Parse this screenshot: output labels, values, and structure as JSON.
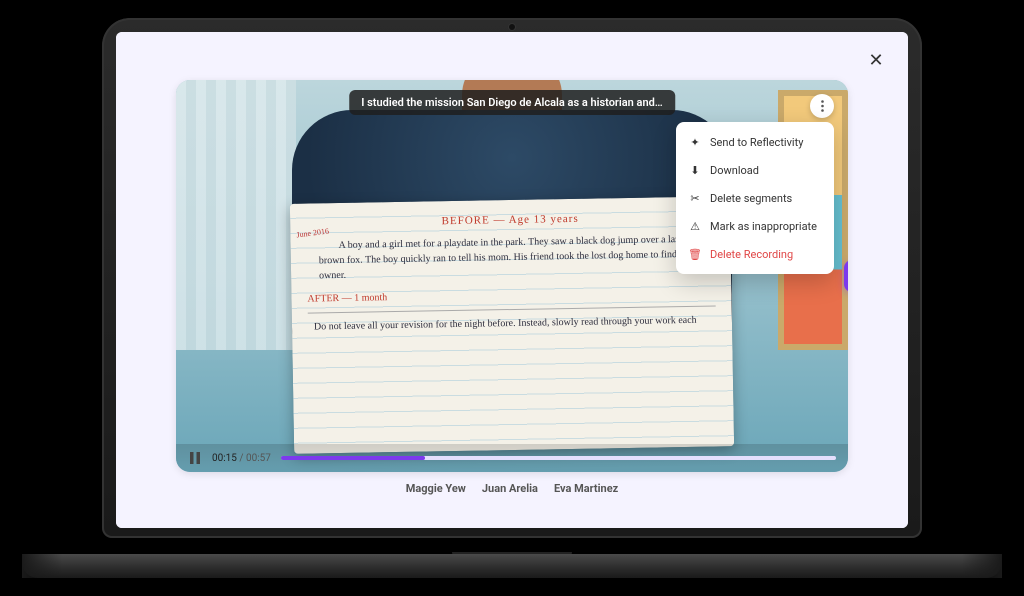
{
  "colors": {
    "accent": "#7c3aed",
    "danger": "#e04646"
  },
  "close_label": "✕",
  "caption": {
    "text": "I studied the mission San Diego de Alcala as a historian and…"
  },
  "paper": {
    "side_date": "June 2016",
    "heading_before": "BEFORE — Age 13 years",
    "paragraph": "A boy and a girl met for a playdate in the park. They saw a black dog jump over a lazy brown fox. The boy quickly ran to tell his mom. His friend took the lost dog home to find it's owner.",
    "heading_after": "AFTER — 1 month",
    "paragraph2": "Do not leave all your revision for the night before. Instead, slowly read through your work each"
  },
  "menu": {
    "items": [
      {
        "icon": "sparkle-icon",
        "glyph": "✦",
        "label": "Send to Reflectivity",
        "danger": false
      },
      {
        "icon": "download-icon",
        "glyph": "⬇",
        "label": "Download",
        "danger": false
      },
      {
        "icon": "scissors-icon",
        "glyph": "✂",
        "label": "Delete segments",
        "danger": false
      },
      {
        "icon": "warning-icon",
        "glyph": "⚠",
        "label": "Mark as inappropriate",
        "danger": false
      },
      {
        "icon": "trash-icon",
        "glyph": "🗑",
        "label": "Delete Recording",
        "danger": true
      }
    ]
  },
  "player": {
    "state": "playing",
    "current": "00:15",
    "separator": " / ",
    "duration": "00:57",
    "progress_pct": 26
  },
  "students": [
    "Maggie Yew",
    "Juan Arelia",
    "Eva Martinez"
  ]
}
